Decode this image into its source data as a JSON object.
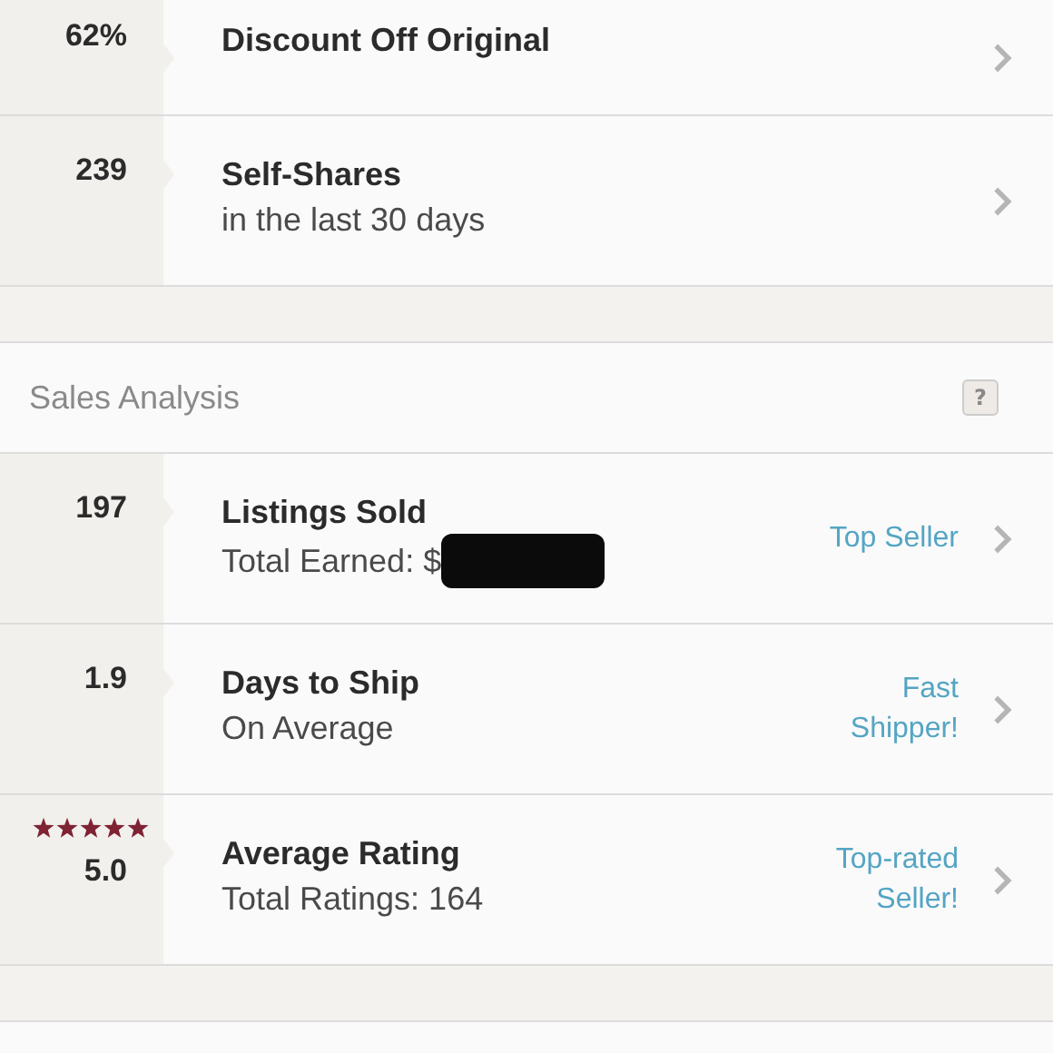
{
  "top_rows": [
    {
      "kind": "stat",
      "value": "62%",
      "title": "Discount Off Original"
    },
    {
      "kind": "stat",
      "value": "239",
      "title": "Self-Shares",
      "subtitle": "in the last 30 days"
    }
  ],
  "sales_analysis": {
    "header": "Sales Analysis",
    "help": "?",
    "rows": [
      {
        "kind": "stat",
        "value": "197",
        "title": "Listings Sold",
        "subtitle": "Total Earned: $",
        "redacted": true,
        "badge": "Top Seller"
      },
      {
        "kind": "stat",
        "value": "1.9",
        "title": "Days to Ship",
        "subtitle": "On Average",
        "badge": "Fast Shipper!"
      },
      {
        "kind": "rating",
        "value": "5.0",
        "stars": 5,
        "title": "Average Rating",
        "subtitle": "Total Ratings: 164",
        "badge": "Top-rated Seller!"
      }
    ]
  }
}
